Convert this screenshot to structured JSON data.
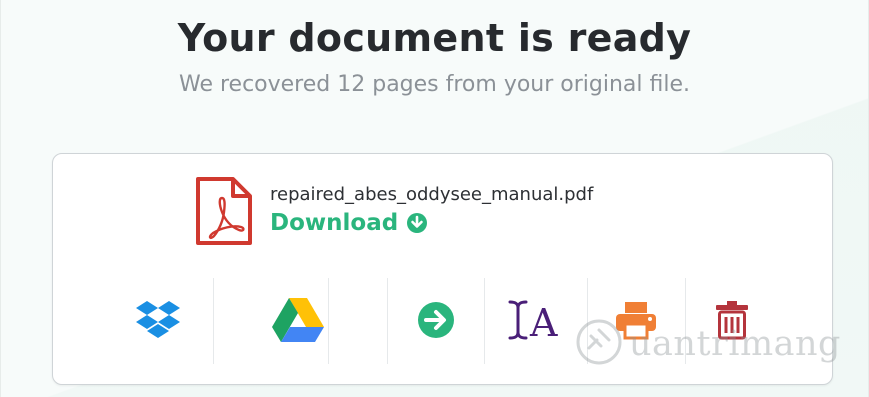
{
  "header": {
    "title": "Your document is ready",
    "subtitle": "We recovered 12 pages from your original file."
  },
  "file": {
    "name": "repaired_abes_oddysee_manual.pdf",
    "icon": "pdf-file-icon",
    "download_label": "Download",
    "download_icon": "arrow-down-circle-icon"
  },
  "actions": [
    {
      "name": "dropbox-button",
      "icon": "dropbox-icon",
      "color": "#1a8fe3"
    },
    {
      "name": "google-drive-button",
      "icon": "google-drive-icon",
      "color": "#2ab57d"
    },
    {
      "name": "next-button",
      "icon": "arrow-right-circle-icon",
      "color": "#2ab57d"
    },
    {
      "name": "ocr-button",
      "icon": "ocr-text-icon",
      "color": "#4a1f78"
    },
    {
      "name": "print-button",
      "icon": "printer-icon",
      "color": "#f07f35"
    },
    {
      "name": "delete-button",
      "icon": "trash-icon",
      "color": "#b4343c"
    }
  ],
  "watermark": {
    "text": "uantrimang"
  },
  "colors": {
    "accent": "#2ab57d",
    "pdf_red": "#d0392f",
    "title": "#272a2e",
    "subtitle": "#8b9197"
  }
}
